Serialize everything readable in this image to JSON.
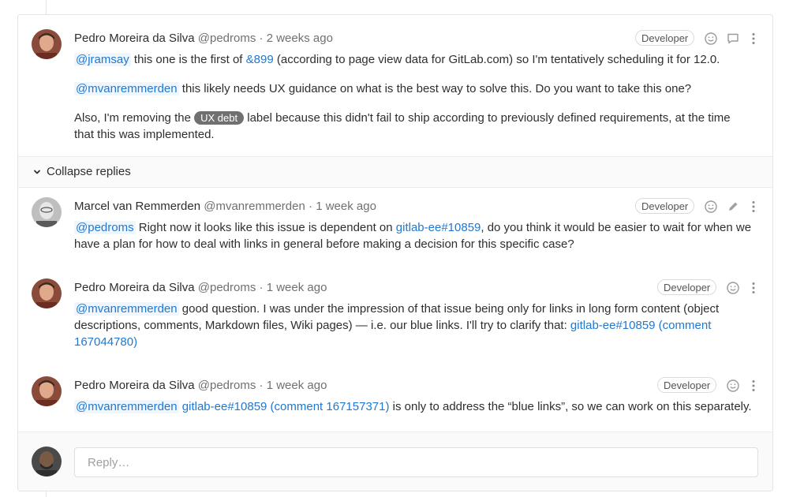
{
  "thread": {
    "main_note": {
      "author_name": "Pedro Moreira da Silva",
      "author_handle": "@pedroms",
      "time": "2 weeks ago",
      "role_badge": "Developer",
      "p1": {
        "mention": "@jramsay",
        "text1": " this one is the first of ",
        "link": "&899",
        "text2": " (according to page view data for GitLab.com) so I'm tentatively scheduling it for 12.0."
      },
      "p2": {
        "mention": "@mvanremmerden",
        "text": " this likely needs UX guidance on what is the best way to solve this. Do you want to take this one?"
      },
      "p3": {
        "text1": "Also, I'm removing the ",
        "label": "UX debt",
        "text2": " label because this didn't fail to ship according to previously defined requirements, at the time that this was implemented."
      }
    },
    "collapse_label": "Collapse replies",
    "replies": [
      {
        "author_name": "Marcel van Remmerden",
        "author_handle": "@mvanremmerden",
        "time": "1 week ago",
        "role_badge": "Developer",
        "mention": "@pedroms",
        "text1": " Right now it looks like this issue is dependent on ",
        "link": "gitlab-ee#10859",
        "text2": ", do you think it would be easier to wait for when we have a plan for how to deal with links in general before making a decision for this specific case?"
      },
      {
        "author_name": "Pedro Moreira da Silva",
        "author_handle": "@pedroms",
        "time": "1 week ago",
        "role_badge": "Developer",
        "mention": "@mvanremmerden",
        "text1": " good question. I was under the impression of that issue being only for links in long form content (object descriptions, comments, Markdown files, Wiki pages) — i.e. our blue links. I'll try to clarify that: ",
        "link": "gitlab-ee#10859 (comment 167044780)"
      },
      {
        "author_name": "Pedro Moreira da Silva",
        "author_handle": "@pedroms",
        "time": "1 week ago",
        "role_badge": "Developer",
        "mention": "@mvanremmerden",
        "link": "gitlab-ee#10859 (comment 167157371)",
        "text1": " is only to address the “blue links”, so we can work on this separately."
      }
    ],
    "reply_placeholder": "Reply…",
    "separator": " · ",
    "colors": {
      "link": "#1f78d1",
      "label_bg": "#707070",
      "muted": "#707070"
    },
    "icons": [
      "smiley-icon",
      "comment-icon",
      "kebab-menu-icon",
      "pencil-icon",
      "chevron-down-icon"
    ]
  }
}
